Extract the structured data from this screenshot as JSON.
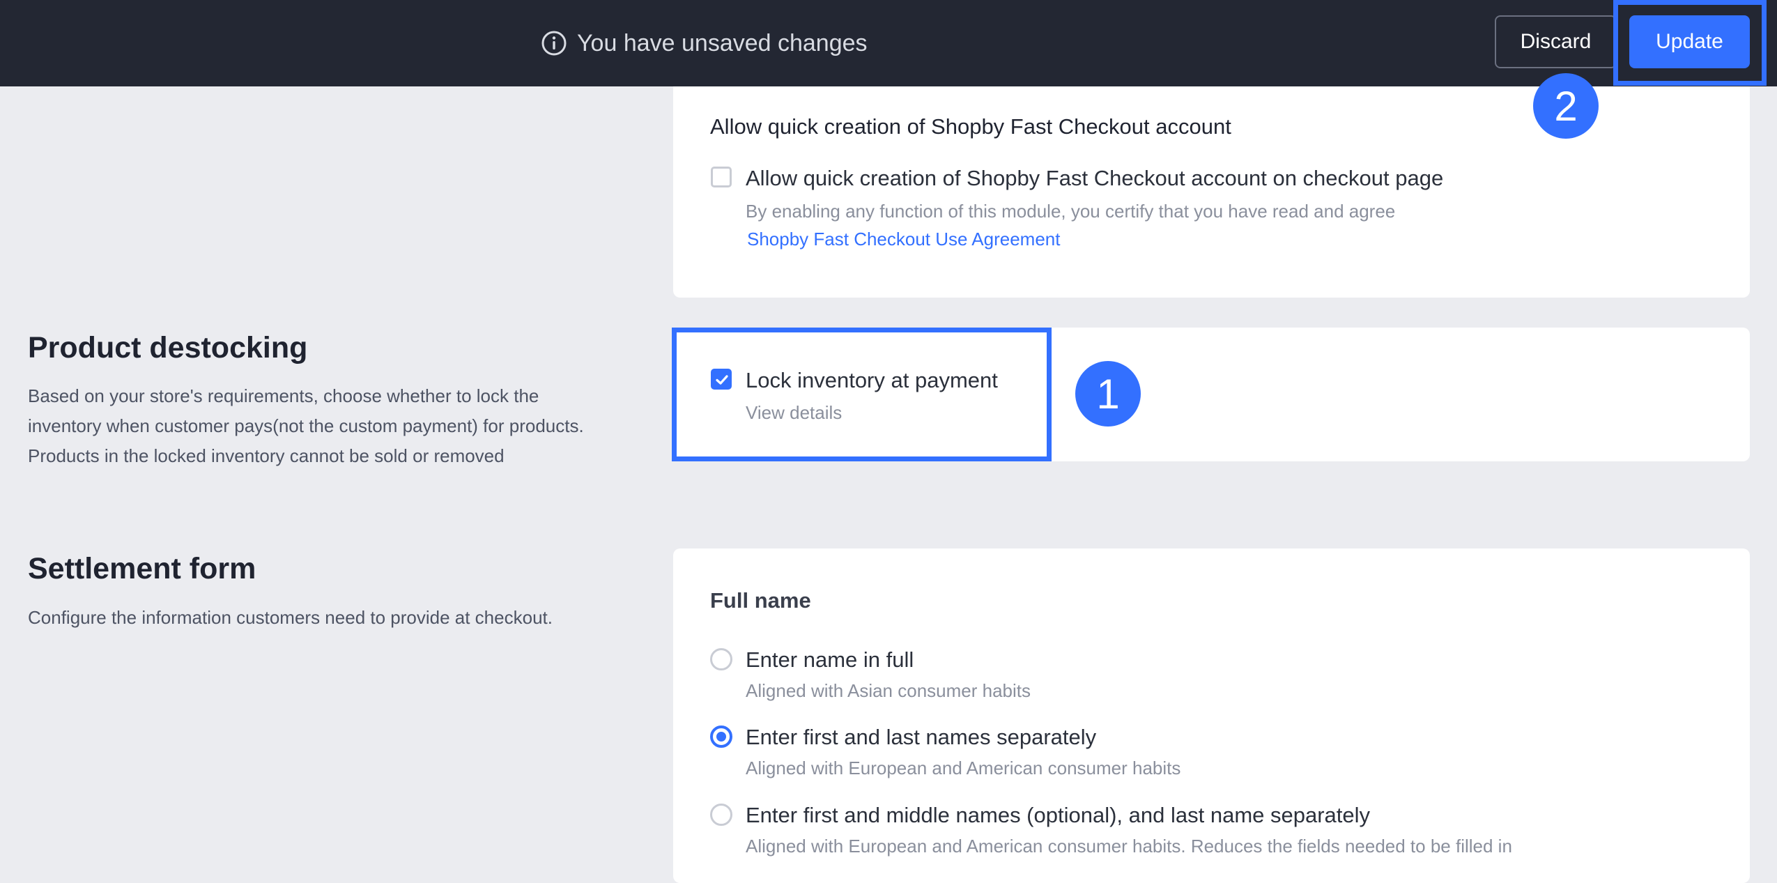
{
  "topbar": {
    "unsaved_text": "You have unsaved changes",
    "discard_label": "Discard",
    "update_label": "Update"
  },
  "markers": {
    "one": "1",
    "two": "2"
  },
  "fast_checkout": {
    "title": "Allow quick creation of Shopby Fast Checkout account",
    "checkbox_label": "Allow quick creation of Shopby Fast Checkout account on checkout page",
    "checked": false,
    "description": "By enabling any function of this module, you certify that you have read and agree",
    "link_text": "Shopby Fast Checkout Use Agreement"
  },
  "destocking": {
    "title": "Product destocking",
    "description": "Based on your store's requirements, choose whether to lock the inventory when customer pays(not the custom payment) for products. Products in the locked inventory cannot be sold or removed",
    "checkbox_label": "Lock inventory at payment",
    "checked": true,
    "details_link": "View details"
  },
  "settlement": {
    "title": "Settlement form",
    "description": "Configure the information customers need to provide at checkout.",
    "full_name_title": "Full name",
    "options": [
      {
        "label": "Enter name in full",
        "desc": "Aligned with Asian consumer habits",
        "selected": false
      },
      {
        "label": "Enter first and last names separately",
        "desc": "Aligned with European and American consumer habits",
        "selected": true
      },
      {
        "label": "Enter first and middle names (optional), and last name separately",
        "desc": "Aligned with European and American consumer habits. Reduces the fields needed to be filled in",
        "selected": false
      }
    ]
  },
  "colors": {
    "accent": "#3370ff",
    "topbar_bg": "#232733",
    "page_bg": "#ebecf0"
  }
}
